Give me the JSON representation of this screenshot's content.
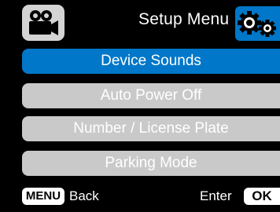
{
  "header": {
    "title": "Setup Menu",
    "mode_icon": "video-camera-icon",
    "settings_icon": "gears-icon"
  },
  "menu": {
    "items": [
      {
        "label": "Device Sounds",
        "selected": true
      },
      {
        "label": "Auto Power Off",
        "selected": false
      },
      {
        "label": "Number / License Plate",
        "selected": false
      },
      {
        "label": "Parking Mode",
        "selected": false
      }
    ]
  },
  "footer": {
    "menu_key": "MENU",
    "back_label": "Back",
    "enter_label": "Enter",
    "ok_key": "OK"
  },
  "colors": {
    "accent": "#0077c8",
    "item_bg": "#c9c9c9",
    "background": "#000000"
  }
}
